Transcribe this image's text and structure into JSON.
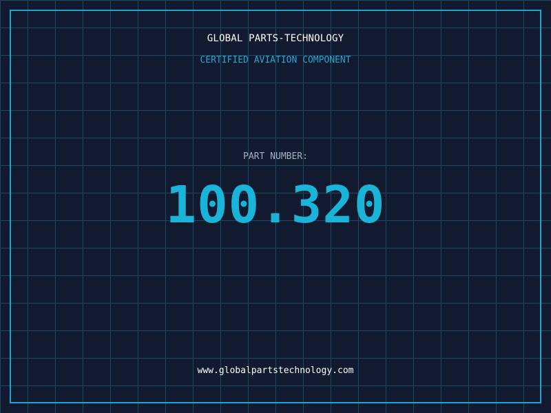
{
  "header": {
    "company": "GLOBAL PARTS-TECHNOLOGY",
    "subtitle": "CERTIFIED AVIATION COMPONENT"
  },
  "part": {
    "label": "PART NUMBER:",
    "number": "100.320"
  },
  "footer": {
    "website": "www.globalpartstechnology.com"
  },
  "colors": {
    "background": "#111a2e",
    "grid": "#1d4a62",
    "accent": "#19b4d8",
    "frame": "#1aa7cf"
  }
}
